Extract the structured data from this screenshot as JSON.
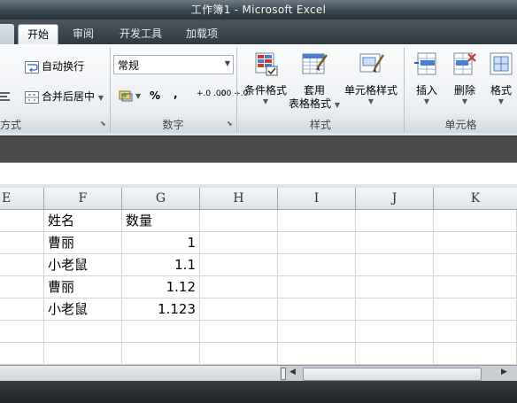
{
  "window": {
    "title": "工作簿1 - Microsoft Excel"
  },
  "tabs": [
    {
      "label": "开始",
      "active": true
    },
    {
      "label": "审阅",
      "active": false
    },
    {
      "label": "开发工具",
      "active": false
    },
    {
      "label": "加载项",
      "active": false
    }
  ],
  "ribbon": {
    "alignment": {
      "wrap_text": "自动换行",
      "merge_center": "合并后居中",
      "group_label_partial": "方式"
    },
    "number": {
      "format_value": "常规",
      "percent": "%",
      "comma": ",",
      "increase_decimal": "+.0 .00",
      "decrease_decimal": ".00 +.0",
      "group_label": "数字"
    },
    "styles": {
      "conditional_format": "条件格式",
      "table_format_line1": "套用",
      "table_format_line2": "表格格式",
      "cell_styles": "单元格样式",
      "group_label": "样式"
    },
    "cells": {
      "insert": "插入",
      "delete": "删除",
      "format_partial": "格式",
      "group_label": "单元格"
    }
  },
  "grid": {
    "columns": [
      "E",
      "F",
      "G",
      "H",
      "I",
      "J",
      "K"
    ],
    "rows": [
      {
        "F": "姓名",
        "G": "数量"
      },
      {
        "F": "曹丽",
        "G": "1"
      },
      {
        "F": "小老鼠",
        "G": "1.1"
      },
      {
        "F": "曹丽",
        "G": "1.12"
      },
      {
        "F": "小老鼠",
        "G": "1.123"
      },
      {
        "F": "",
        "G": ""
      },
      {
        "F": "",
        "G": ""
      }
    ]
  },
  "colors": {
    "ribbon_bg": "#eef1f4",
    "title_bar": "#3a4650",
    "grid_line": "#d4d4d4"
  }
}
